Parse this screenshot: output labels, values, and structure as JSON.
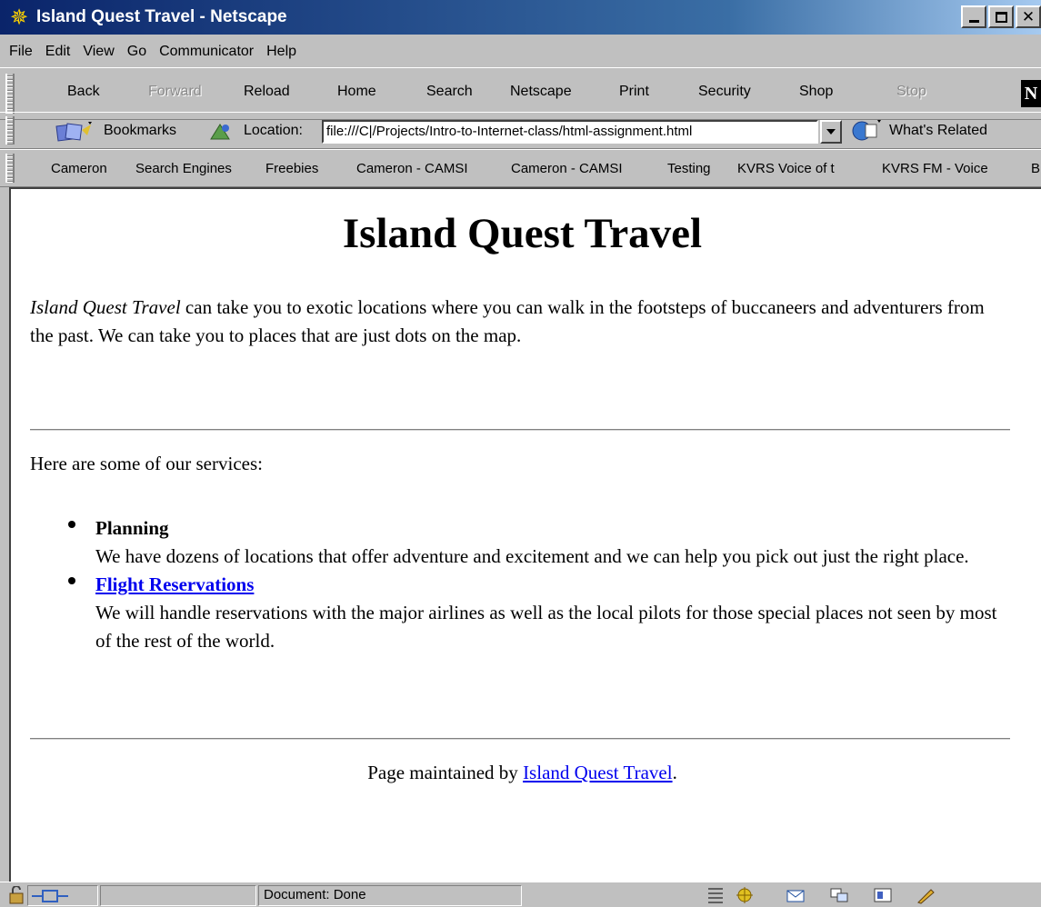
{
  "window": {
    "title": "Island Quest Travel - Netscape"
  },
  "menu": [
    "File",
    "Edit",
    "View",
    "Go",
    "Communicator",
    "Help"
  ],
  "nav_buttons": [
    {
      "label": "Back",
      "enabled": true
    },
    {
      "label": "Forward",
      "enabled": false
    },
    {
      "label": "Reload",
      "enabled": true
    },
    {
      "label": "Home",
      "enabled": true
    },
    {
      "label": "Search",
      "enabled": true
    },
    {
      "label": "Netscape",
      "enabled": true
    },
    {
      "label": "Print",
      "enabled": true
    },
    {
      "label": "Security",
      "enabled": true
    },
    {
      "label": "Shop",
      "enabled": true
    },
    {
      "label": "Stop",
      "enabled": false
    }
  ],
  "location_bar": {
    "bookmarks_label": "Bookmarks",
    "location_label": "Location:",
    "url": "file:///C|/Projects/Intro-to-Internet-class/html-assignment.html",
    "related_label": "What's Related"
  },
  "personal_toolbar": [
    "Cameron",
    "Search Engines",
    "Freebies",
    "Cameron - CAMSI",
    "Cameron - CAMSI",
    "Testing",
    "KVRS Voice of t",
    "KVRS FM - Voice",
    "B"
  ],
  "page": {
    "heading": "Island Quest Travel",
    "intro_em": "Island Quest Travel",
    "intro_rest": " can take you to exotic locations where you can walk in the footsteps of buccaneers and adventurers from the past. We can take you to places that are just dots on the map.",
    "services_intro": "Here are some of our services:",
    "services": [
      {
        "title": "Planning",
        "is_link": false,
        "description": "We have dozens of locations that offer adventure and excitement and we can help you pick out just the right place."
      },
      {
        "title": "Flight Reservations",
        "is_link": true,
        "description": "We will handle reservations with the major airlines as well as the local pilots for those special places not seen by most of the rest of the world."
      }
    ],
    "footer_prefix": "Page maintained by ",
    "footer_link": "Island Quest Travel",
    "footer_suffix": "."
  },
  "status": {
    "text": "Document: Done"
  },
  "colors": {
    "title_bar": "#0a246a",
    "link": "#0000ee",
    "chrome": "#c0c0c0"
  }
}
